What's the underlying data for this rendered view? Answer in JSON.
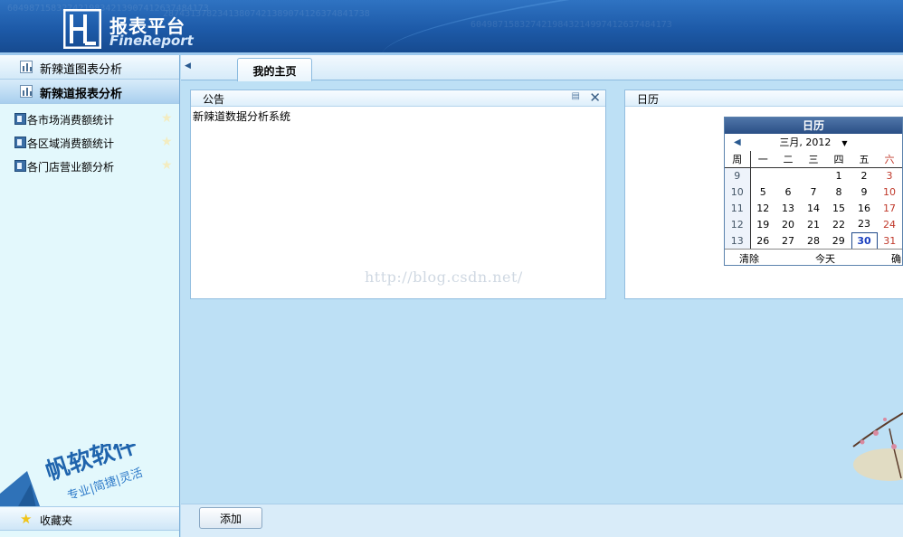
{
  "header": {
    "brand_title": "报表平台",
    "brand_subtitle": "FineReport",
    "bg_digits": [
      "6049871583274219834213907412637484173",
      "28743137823413807421389074126374841738",
      "6049871583274219843214997412637484173"
    ]
  },
  "sidebar": {
    "groups": [
      {
        "label": "新辣道图表分析"
      },
      {
        "label": "新辣道报表分析"
      }
    ],
    "tree_items": [
      {
        "label": "各市场消费额统计"
      },
      {
        "label": "各区域消费额统计"
      },
      {
        "label": "各门店营业额分析"
      }
    ],
    "brand_name": "帆软软件",
    "brand_slogan": "专业|简捷|灵活",
    "favorites_label": "收藏夹"
  },
  "main": {
    "tab_label": "我的主页",
    "notice_panel": {
      "title": "公告",
      "body": "新辣道数据分析系统"
    },
    "calendar_panel": {
      "title": "日历"
    },
    "watermark": "http://blog.csdn.net/",
    "add_button": "添加"
  },
  "calendar": {
    "header": "日历",
    "month_label": "三月, 2012",
    "weekday_headers": [
      "周",
      "一",
      "二",
      "三",
      "四",
      "五",
      "六"
    ],
    "rows": [
      {
        "week": "9",
        "days": [
          "",
          "",
          "",
          "1",
          "2",
          "3"
        ]
      },
      {
        "week": "10",
        "days": [
          "5",
          "6",
          "7",
          "8",
          "9",
          "10"
        ]
      },
      {
        "week": "11",
        "days": [
          "12",
          "13",
          "14",
          "15",
          "16",
          "17"
        ]
      },
      {
        "week": "12",
        "days": [
          "19",
          "20",
          "21",
          "22",
          "23",
          "24"
        ]
      },
      {
        "week": "13",
        "days": [
          "26",
          "27",
          "28",
          "29",
          "30",
          "31"
        ]
      }
    ],
    "selected_day": "30",
    "footer": {
      "clear": "清除",
      "today": "今天",
      "confirm": "确定"
    }
  },
  "colors": {
    "header_blue": "#1d5aa8",
    "sidebar_bg": "#e3f8fc",
    "main_bg": "#bde0f5",
    "saturday_red": "#c0392b",
    "today_blue": "#1a3fbf"
  }
}
